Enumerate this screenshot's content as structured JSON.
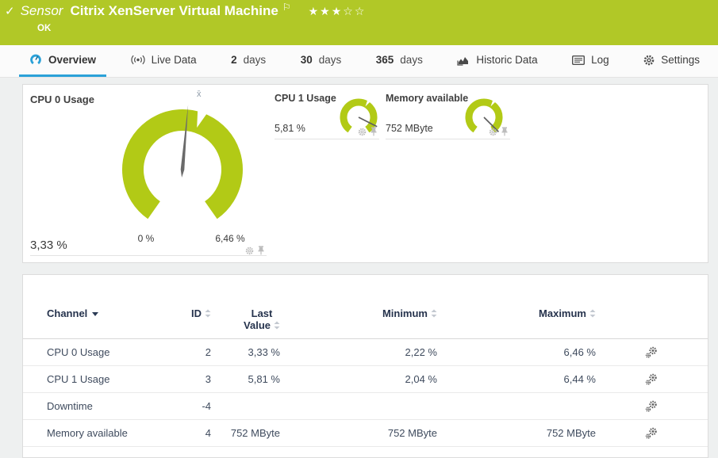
{
  "header": {
    "check": "✓",
    "kind_label": "Sensor",
    "title": "Citrix XenServer Virtual Machine",
    "flag": "⚐",
    "status": "OK",
    "stars": {
      "filled_char": "★",
      "empty_char": "☆",
      "filled": 3,
      "total": 5
    }
  },
  "tabs": {
    "overview": "Overview",
    "live_data": "Live Data",
    "d2_num": "2",
    "d2_suffix": "days",
    "d30_num": "30",
    "d30_suffix": "days",
    "d365_num": "365",
    "d365_suffix": "days",
    "historic": "Historic Data",
    "log": "Log",
    "settings": "Settings"
  },
  "gauges": {
    "cpu0": {
      "label": "CPU 0 Usage",
      "value": "3,33 %",
      "scale_min": "0 %",
      "scale_max": "6,46 %",
      "avg_marker": "x̄"
    },
    "cpu1": {
      "label": "CPU 1 Usage",
      "value": "5,81 %"
    },
    "memory": {
      "label": "Memory available",
      "value": "752 MByte"
    }
  },
  "table": {
    "headers": {
      "channel": "Channel",
      "id": "ID",
      "last_line1": "Last",
      "last_line2": "Value",
      "minimum": "Minimum",
      "maximum": "Maximum"
    },
    "rows": [
      {
        "channel": "CPU 0 Usage",
        "id": "2",
        "last": "3,33 %",
        "min": "2,22 %",
        "max": "6,46 %"
      },
      {
        "channel": "CPU 1 Usage",
        "id": "3",
        "last": "5,81 %",
        "min": "2,04 %",
        "max": "6,44 %"
      },
      {
        "channel": "Downtime",
        "id": "-4",
        "last": "",
        "min": "",
        "max": ""
      },
      {
        "channel": "Memory available",
        "id": "4",
        "last": "752 MByte",
        "min": "752 MByte",
        "max": "752 MByte"
      }
    ]
  },
  "colors": {
    "brand_green": "#b1c827",
    "gauge_green": "#b2ca16",
    "accent_blue": "#2aa1d8",
    "header_text": "#26334d",
    "cell_text": "#3f4b5e"
  }
}
